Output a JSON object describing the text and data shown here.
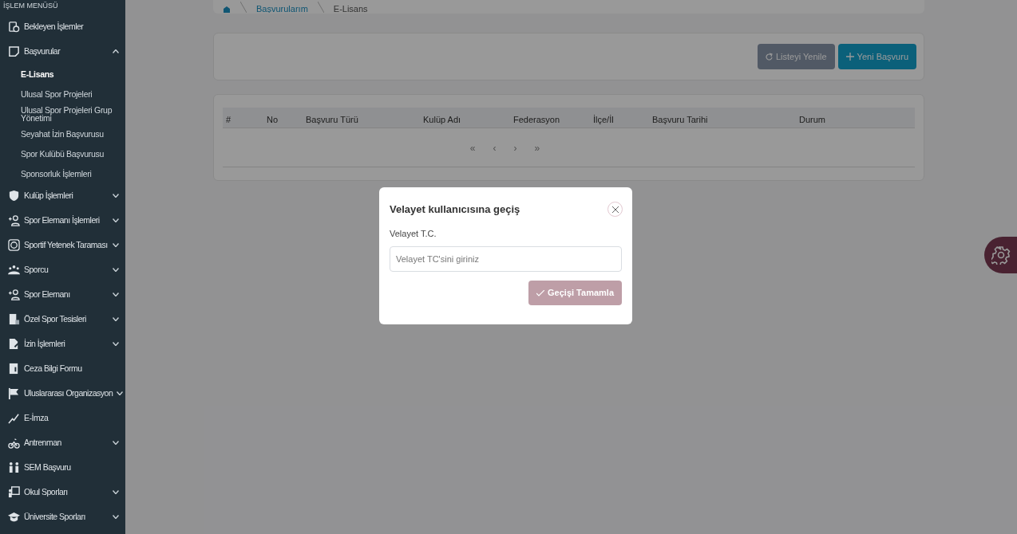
{
  "sidebar": {
    "heading": "İŞLEM MENÜSÜ",
    "items": [
      {
        "kind": "link",
        "label": "Bekleyen İşlemler"
      },
      {
        "kind": "group",
        "label": "Başvurular",
        "expanded": true,
        "children": [
          {
            "label": "E-Lisans",
            "selected": true
          },
          {
            "label": "Ulusal Spor Projeleri",
            "selected": false
          },
          {
            "label": "Ulusal Spor Projeleri Grup Yönetimi",
            "selected": false
          },
          {
            "label": "Seyahat İzin Başvurusu",
            "selected": false
          },
          {
            "label": "Spor Kulübü Başvurusu",
            "selected": false
          },
          {
            "label": "Sponsorluk İşlemleri",
            "selected": false
          }
        ]
      },
      {
        "kind": "group",
        "label": "Kulüp İşlemleri",
        "expanded": false
      },
      {
        "kind": "group",
        "label": "Spor Elemanı İşlemleri",
        "expanded": false
      },
      {
        "kind": "group",
        "label": "Sportif Yetenek Taraması",
        "expanded": false
      },
      {
        "kind": "group",
        "label": "Sporcu",
        "expanded": false
      },
      {
        "kind": "group",
        "label": "Spor Elemanı",
        "expanded": false
      },
      {
        "kind": "group",
        "label": "Özel Spor Tesisleri",
        "expanded": false
      },
      {
        "kind": "group",
        "label": "İzin İşlemleri",
        "expanded": false
      },
      {
        "kind": "link",
        "label": "Ceza Bilgi Formu"
      },
      {
        "kind": "group",
        "label": "Uluslararası Organizasyon",
        "expanded": false
      },
      {
        "kind": "link",
        "label": "E-İmza"
      },
      {
        "kind": "group",
        "label": "Antrenman",
        "expanded": false
      },
      {
        "kind": "link",
        "label": "SEM Başvuru"
      },
      {
        "kind": "group",
        "label": "Okul Sporları",
        "expanded": false
      },
      {
        "kind": "group",
        "label": "Üniversite Sporları",
        "expanded": false
      }
    ]
  },
  "breadcrumb": [
    "Başvurularım",
    "E-Lisans"
  ],
  "toolbar": {
    "buttons": [
      {
        "kind": "refresh",
        "label": "Listeyi Yenile"
      },
      {
        "kind": "add",
        "label": "Yeni Başvuru"
      }
    ]
  },
  "table": {
    "columns": [
      "#",
      "No",
      "Başvuru Türü",
      "Kulüp Adı",
      "Federasyon",
      "İlçe/İl",
      "Başvuru Tarihi",
      "Durum"
    ],
    "pager": [
      "«",
      "‹",
      "›",
      "»"
    ]
  },
  "modal": {
    "title": "Velayet kullanıcısına geçiş",
    "field_label": "Velayet T.C.",
    "placeholder": "Velayet TC'sini giriniz",
    "submit": {
      "label": "Geçişi Tamamla",
      "disabled": true
    }
  }
}
